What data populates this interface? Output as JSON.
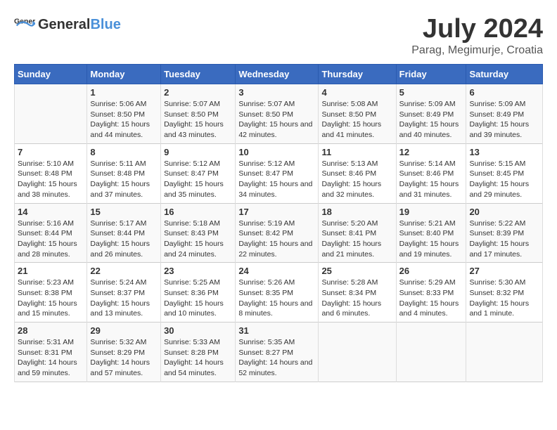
{
  "logo": {
    "general": "General",
    "blue": "Blue"
  },
  "title": "July 2024",
  "subtitle": "Parag, Megimurje, Croatia",
  "days_header": [
    "Sunday",
    "Monday",
    "Tuesday",
    "Wednesday",
    "Thursday",
    "Friday",
    "Saturday"
  ],
  "weeks": [
    [
      {
        "day": "",
        "sunrise": "",
        "sunset": "",
        "daylight": ""
      },
      {
        "day": "1",
        "sunrise": "Sunrise: 5:06 AM",
        "sunset": "Sunset: 8:50 PM",
        "daylight": "Daylight: 15 hours and 44 minutes."
      },
      {
        "day": "2",
        "sunrise": "Sunrise: 5:07 AM",
        "sunset": "Sunset: 8:50 PM",
        "daylight": "Daylight: 15 hours and 43 minutes."
      },
      {
        "day": "3",
        "sunrise": "Sunrise: 5:07 AM",
        "sunset": "Sunset: 8:50 PM",
        "daylight": "Daylight: 15 hours and 42 minutes."
      },
      {
        "day": "4",
        "sunrise": "Sunrise: 5:08 AM",
        "sunset": "Sunset: 8:50 PM",
        "daylight": "Daylight: 15 hours and 41 minutes."
      },
      {
        "day": "5",
        "sunrise": "Sunrise: 5:09 AM",
        "sunset": "Sunset: 8:49 PM",
        "daylight": "Daylight: 15 hours and 40 minutes."
      },
      {
        "day": "6",
        "sunrise": "Sunrise: 5:09 AM",
        "sunset": "Sunset: 8:49 PM",
        "daylight": "Daylight: 15 hours and 39 minutes."
      }
    ],
    [
      {
        "day": "7",
        "sunrise": "Sunrise: 5:10 AM",
        "sunset": "Sunset: 8:48 PM",
        "daylight": "Daylight: 15 hours and 38 minutes."
      },
      {
        "day": "8",
        "sunrise": "Sunrise: 5:11 AM",
        "sunset": "Sunset: 8:48 PM",
        "daylight": "Daylight: 15 hours and 37 minutes."
      },
      {
        "day": "9",
        "sunrise": "Sunrise: 5:12 AM",
        "sunset": "Sunset: 8:47 PM",
        "daylight": "Daylight: 15 hours and 35 minutes."
      },
      {
        "day": "10",
        "sunrise": "Sunrise: 5:12 AM",
        "sunset": "Sunset: 8:47 PM",
        "daylight": "Daylight: 15 hours and 34 minutes."
      },
      {
        "day": "11",
        "sunrise": "Sunrise: 5:13 AM",
        "sunset": "Sunset: 8:46 PM",
        "daylight": "Daylight: 15 hours and 32 minutes."
      },
      {
        "day": "12",
        "sunrise": "Sunrise: 5:14 AM",
        "sunset": "Sunset: 8:46 PM",
        "daylight": "Daylight: 15 hours and 31 minutes."
      },
      {
        "day": "13",
        "sunrise": "Sunrise: 5:15 AM",
        "sunset": "Sunset: 8:45 PM",
        "daylight": "Daylight: 15 hours and 29 minutes."
      }
    ],
    [
      {
        "day": "14",
        "sunrise": "Sunrise: 5:16 AM",
        "sunset": "Sunset: 8:44 PM",
        "daylight": "Daylight: 15 hours and 28 minutes."
      },
      {
        "day": "15",
        "sunrise": "Sunrise: 5:17 AM",
        "sunset": "Sunset: 8:44 PM",
        "daylight": "Daylight: 15 hours and 26 minutes."
      },
      {
        "day": "16",
        "sunrise": "Sunrise: 5:18 AM",
        "sunset": "Sunset: 8:43 PM",
        "daylight": "Daylight: 15 hours and 24 minutes."
      },
      {
        "day": "17",
        "sunrise": "Sunrise: 5:19 AM",
        "sunset": "Sunset: 8:42 PM",
        "daylight": "Daylight: 15 hours and 22 minutes."
      },
      {
        "day": "18",
        "sunrise": "Sunrise: 5:20 AM",
        "sunset": "Sunset: 8:41 PM",
        "daylight": "Daylight: 15 hours and 21 minutes."
      },
      {
        "day": "19",
        "sunrise": "Sunrise: 5:21 AM",
        "sunset": "Sunset: 8:40 PM",
        "daylight": "Daylight: 15 hours and 19 minutes."
      },
      {
        "day": "20",
        "sunrise": "Sunrise: 5:22 AM",
        "sunset": "Sunset: 8:39 PM",
        "daylight": "Daylight: 15 hours and 17 minutes."
      }
    ],
    [
      {
        "day": "21",
        "sunrise": "Sunrise: 5:23 AM",
        "sunset": "Sunset: 8:38 PM",
        "daylight": "Daylight: 15 hours and 15 minutes."
      },
      {
        "day": "22",
        "sunrise": "Sunrise: 5:24 AM",
        "sunset": "Sunset: 8:37 PM",
        "daylight": "Daylight: 15 hours and 13 minutes."
      },
      {
        "day": "23",
        "sunrise": "Sunrise: 5:25 AM",
        "sunset": "Sunset: 8:36 PM",
        "daylight": "Daylight: 15 hours and 10 minutes."
      },
      {
        "day": "24",
        "sunrise": "Sunrise: 5:26 AM",
        "sunset": "Sunset: 8:35 PM",
        "daylight": "Daylight: 15 hours and 8 minutes."
      },
      {
        "day": "25",
        "sunrise": "Sunrise: 5:28 AM",
        "sunset": "Sunset: 8:34 PM",
        "daylight": "Daylight: 15 hours and 6 minutes."
      },
      {
        "day": "26",
        "sunrise": "Sunrise: 5:29 AM",
        "sunset": "Sunset: 8:33 PM",
        "daylight": "Daylight: 15 hours and 4 minutes."
      },
      {
        "day": "27",
        "sunrise": "Sunrise: 5:30 AM",
        "sunset": "Sunset: 8:32 PM",
        "daylight": "Daylight: 15 hours and 1 minute."
      }
    ],
    [
      {
        "day": "28",
        "sunrise": "Sunrise: 5:31 AM",
        "sunset": "Sunset: 8:31 PM",
        "daylight": "Daylight: 14 hours and 59 minutes."
      },
      {
        "day": "29",
        "sunrise": "Sunrise: 5:32 AM",
        "sunset": "Sunset: 8:29 PM",
        "daylight": "Daylight: 14 hours and 57 minutes."
      },
      {
        "day": "30",
        "sunrise": "Sunrise: 5:33 AM",
        "sunset": "Sunset: 8:28 PM",
        "daylight": "Daylight: 14 hours and 54 minutes."
      },
      {
        "day": "31",
        "sunrise": "Sunrise: 5:35 AM",
        "sunset": "Sunset: 8:27 PM",
        "daylight": "Daylight: 14 hours and 52 minutes."
      },
      {
        "day": "",
        "sunrise": "",
        "sunset": "",
        "daylight": ""
      },
      {
        "day": "",
        "sunrise": "",
        "sunset": "",
        "daylight": ""
      },
      {
        "day": "",
        "sunrise": "",
        "sunset": "",
        "daylight": ""
      }
    ]
  ]
}
